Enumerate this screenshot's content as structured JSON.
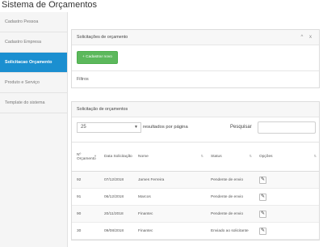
{
  "app": {
    "title": "Sistema de Orçamentos"
  },
  "sidebar": {
    "items": [
      {
        "label": "Cadastro Pessoa"
      },
      {
        "label": "Cadastro Empresa"
      },
      {
        "label": "Solicitacao Orçamento",
        "active": true
      },
      {
        "label": "Produto e Serviço"
      },
      {
        "label": "Template do sistema"
      }
    ]
  },
  "requests_panel": {
    "title": "Solicitações de orçamento",
    "tools": "^ x",
    "new_button": "+ Cadastrar novo",
    "filters_label": "Filtros"
  },
  "list_panel": {
    "title": "Solicitação de orçamentos",
    "page_size": "25",
    "per_page_label": "resultados por página",
    "search_label": "Pesquisar",
    "search_value": ""
  },
  "table": {
    "headers": {
      "num": "Nº Orçamento",
      "date": "Data Solicitação",
      "name": "Nome",
      "status": "Status",
      "options": "Opções"
    },
    "rows": [
      {
        "num": "92",
        "date": "07/12/2018",
        "name": "James Ferreira",
        "status": "Pendente de envio"
      },
      {
        "num": "91",
        "date": "06/12/2018",
        "name": "Marcos",
        "status": "Pendente de envio"
      },
      {
        "num": "90",
        "date": "20/11/2018",
        "name": "Finantec",
        "status": "Pendente de envio"
      },
      {
        "num": "30",
        "date": "09/08/2018",
        "name": "Finantec",
        "status": "Enviado ao solicitante"
      }
    ],
    "edit_icon": "pencil-icon"
  },
  "colors": {
    "active": "#1b8fd0",
    "button": "#5cb85c"
  }
}
